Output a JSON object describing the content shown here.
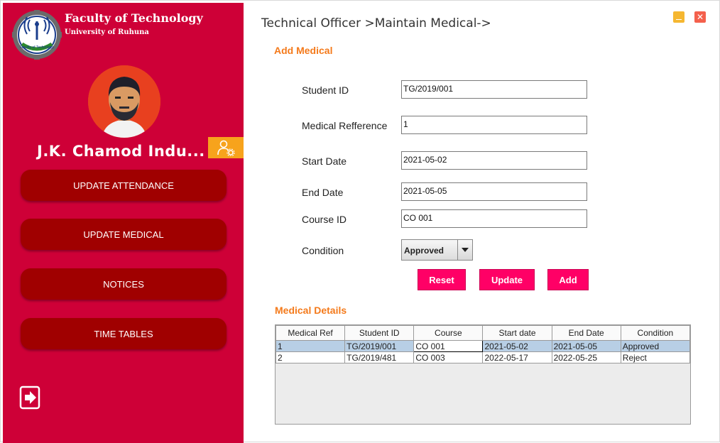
{
  "sidebar": {
    "faculty_title": "Faculty of Technology",
    "faculty_subtitle": "University of Ruhuna",
    "logo_text": "Faculty of Technology",
    "user_name": "J.K. Chamod Indu...",
    "nav": [
      {
        "label": "UPDATE ATTENDANCE"
      },
      {
        "label": "UPDATE MEDICAL"
      },
      {
        "label": "NOTICES"
      },
      {
        "label": "TIME TABLES"
      }
    ],
    "colors": {
      "background": "#ce0037",
      "button": "#a00000",
      "accent": "#f7a31c"
    }
  },
  "header": {
    "breadcrumb": "Technical Officer >Maintain Medical->"
  },
  "form": {
    "title": "Add Medical",
    "student_id_label": "Student ID",
    "student_id_value": "TG/2019/001",
    "medical_ref_label": "Medical Refference",
    "medical_ref_value": "1",
    "start_date_label": "Start Date",
    "start_date_value": "2021-05-02",
    "end_date_label": "End Date",
    "end_date_value": "2021-05-05",
    "course_id_label": "Course ID",
    "course_id_value": "CO 001",
    "condition_label": "Condition",
    "condition_value": "Approved",
    "buttons": {
      "reset": "Reset",
      "update": "Update",
      "add": "Add"
    }
  },
  "details": {
    "title": "Medical Details",
    "columns": [
      "Medical Ref",
      "Student ID",
      "Course",
      "Start date",
      "End Date",
      "Condition"
    ],
    "rows": [
      [
        "1",
        "TG/2019/001",
        "CO 001",
        "2021-05-02",
        "2021-05-05",
        "Approved"
      ],
      [
        "2",
        "TG/2019/481",
        "CO 003",
        "2022-05-17",
        "2022-05-25",
        "Reject"
      ]
    ]
  },
  "colors": {
    "section_title": "#f47a1b",
    "action_button": "#ff0066",
    "selected_row": "#b8cfe5"
  }
}
